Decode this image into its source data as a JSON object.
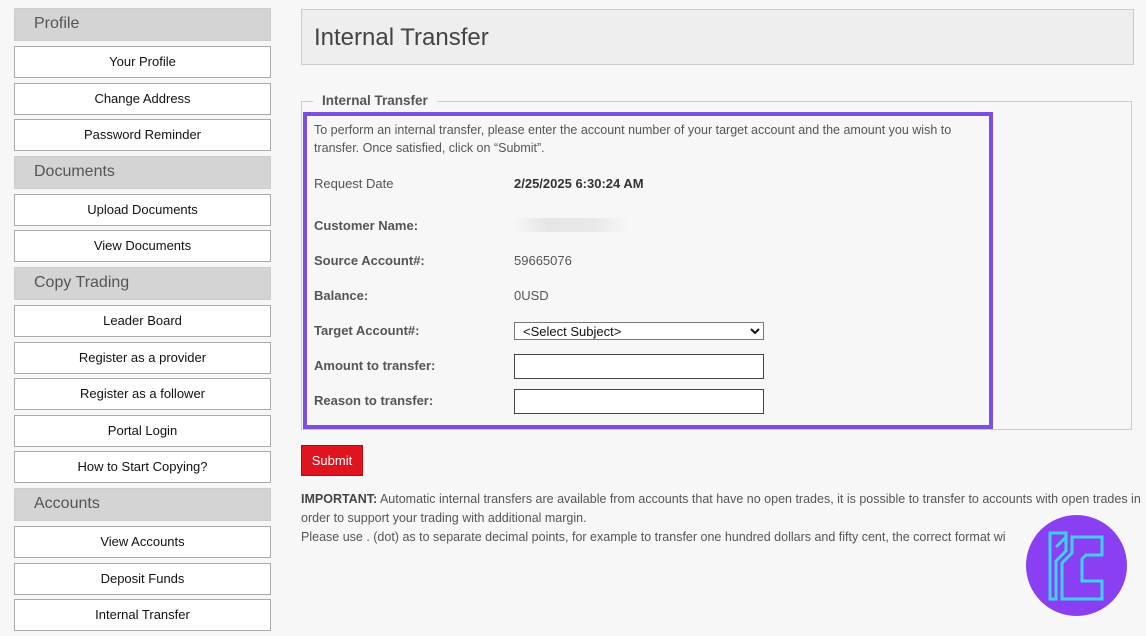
{
  "sidebar": {
    "sections": [
      {
        "title": "Profile",
        "items": [
          "Your Profile",
          "Change Address",
          "Password Reminder"
        ]
      },
      {
        "title": "Documents",
        "items": [
          "Upload Documents",
          "View Documents"
        ]
      },
      {
        "title": "Copy Trading",
        "items": [
          "Leader Board",
          "Register as a provider",
          "Register as a follower",
          "Portal Login",
          "How to Start Copying?"
        ]
      },
      {
        "title": "Accounts",
        "items": [
          "View Accounts",
          "Deposit Funds",
          "Internal Transfer"
        ]
      }
    ]
  },
  "main": {
    "title": "Internal Transfer",
    "legend": "Internal Transfer",
    "intro": "To perform an internal transfer, please enter the account number of your target account and the amount you wish to transfer. Once satisfied, click on “Submit”.",
    "request_date_label": "Request Date",
    "request_date_value": "2/25/2025 6:30:24 AM",
    "customer_name_label": "Customer Name:",
    "source_account_label": "Source Account#:",
    "source_account_value": "59665076",
    "balance_label": "Balance:",
    "balance_value": "0USD",
    "target_account_label": "Target Account#:",
    "target_account_selected": "<Select Subject>",
    "amount_label": "Amount to transfer:",
    "reason_label": "Reason to transfer:",
    "submit_label": "Submit",
    "important_label": "IMPORTANT:",
    "important_text": " Automatic internal transfers are available from accounts that have no open trades, it is possible to transfer to accounts with open trades in order to support your trading with additional margin.",
    "decimal_note": "Please use . (dot) as to separate decimal points, for example to transfer one hundred dollars and fifty cent, the correct format wi"
  },
  "colors": {
    "highlight": "#7b4fe0",
    "submit": "#e0141e",
    "logo": "#8a3ff2",
    "logo_mark": "#3fd0f0"
  },
  "icons": {
    "logo": "tc-logo-icon"
  }
}
